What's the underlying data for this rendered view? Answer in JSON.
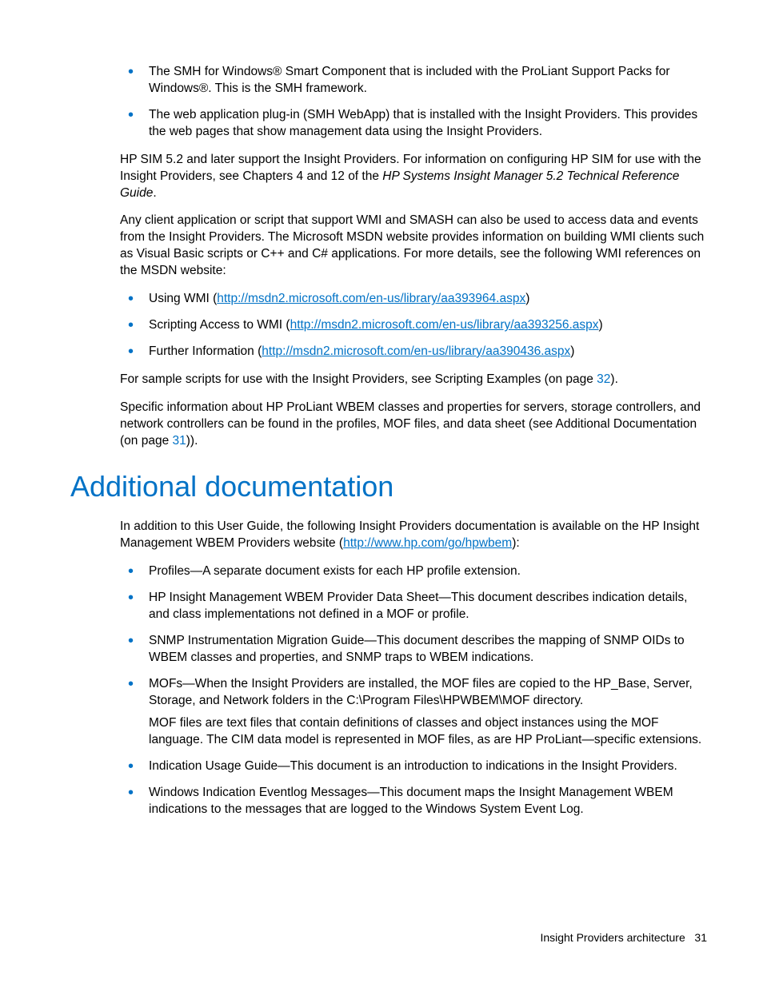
{
  "top_bullets": [
    "The SMH for Windows® Smart Component that is included with the ProLiant Support Packs for Windows®. This is the SMH framework.",
    "The web application plug-in (SMH WebApp) that is installed with the Insight Providers. This provides the web pages that show management data using the Insight Providers."
  ],
  "para_sim_a": "HP SIM 5.2 and later support the Insight Providers. For information on configuring HP SIM for use with the Insight Providers, see Chapters 4 and 12 of the ",
  "para_sim_italic": "HP Systems Insight Manager 5.2 Technical Reference Guide",
  "para_sim_b": ".",
  "para_wmi": "Any client application or script that support WMI and SMASH can also be used to access data and events from the Insight Providers. The Microsoft MSDN website provides information on building WMI clients such as Visual Basic scripts or C++ and C# applications. For more details, see the following WMI references on the MSDN website:",
  "wmi_links": [
    {
      "label": "Using WMI (",
      "url": "http://msdn2.microsoft.com/en-us/library/aa393964.aspx",
      "after": ")"
    },
    {
      "label": "Scripting Access to WMI (",
      "url": "http://msdn2.microsoft.com/en-us/library/aa393256.aspx",
      "after": ")"
    },
    {
      "label": "Further Information (",
      "url": "http://msdn2.microsoft.com/en-us/library/aa390436.aspx",
      "after": ")"
    }
  ],
  "para_samples_a": "For sample scripts for use with the Insight Providers, see Scripting Examples (on page ",
  "para_samples_page": "32",
  "para_samples_b": ").",
  "para_specific_a": "Specific information about HP ProLiant WBEM classes and properties for servers, storage controllers, and network controllers can be found in the profiles, MOF files, and data sheet (see Additional Documentation (on page ",
  "para_specific_page": "31",
  "para_specific_b": ")).",
  "heading": "Additional documentation",
  "intro_a": "In addition to this User Guide, the following Insight Providers documentation is available on the HP Insight Management WBEM Providers website (",
  "intro_url": "http://www.hp.com/go/hpwbem",
  "intro_b": "):",
  "doc_bullets": {
    "b0": "Profiles—A separate document exists for each HP profile extension.",
    "b1": "HP Insight Management WBEM Provider Data Sheet—This document describes indication details, and class implementations not defined in a MOF or profile.",
    "b2": "SNMP Instrumentation Migration Guide—This document describes the mapping of SNMP OIDs to WBEM classes and properties, and SNMP traps to WBEM indications.",
    "b3": "MOFs—When the Insight Providers are installed, the MOF files are copied to the HP_Base, Server, Storage, and Network folders in the C:\\Program Files\\HPWBEM\\MOF directory.",
    "b3_sub": "MOF files are text files that contain definitions of classes and object instances using the MOF language. The CIM data model is represented in MOF files, as are HP ProLiant—specific extensions.",
    "b4": "Indication Usage Guide—This document is an introduction to indications in the Insight Providers.",
    "b5": "Windows Indication Eventlog Messages—This document maps the Insight Management WBEM indications to the messages that are logged to the Windows System Event Log."
  },
  "footer_label": "Insight Providers architecture",
  "footer_page": "31"
}
